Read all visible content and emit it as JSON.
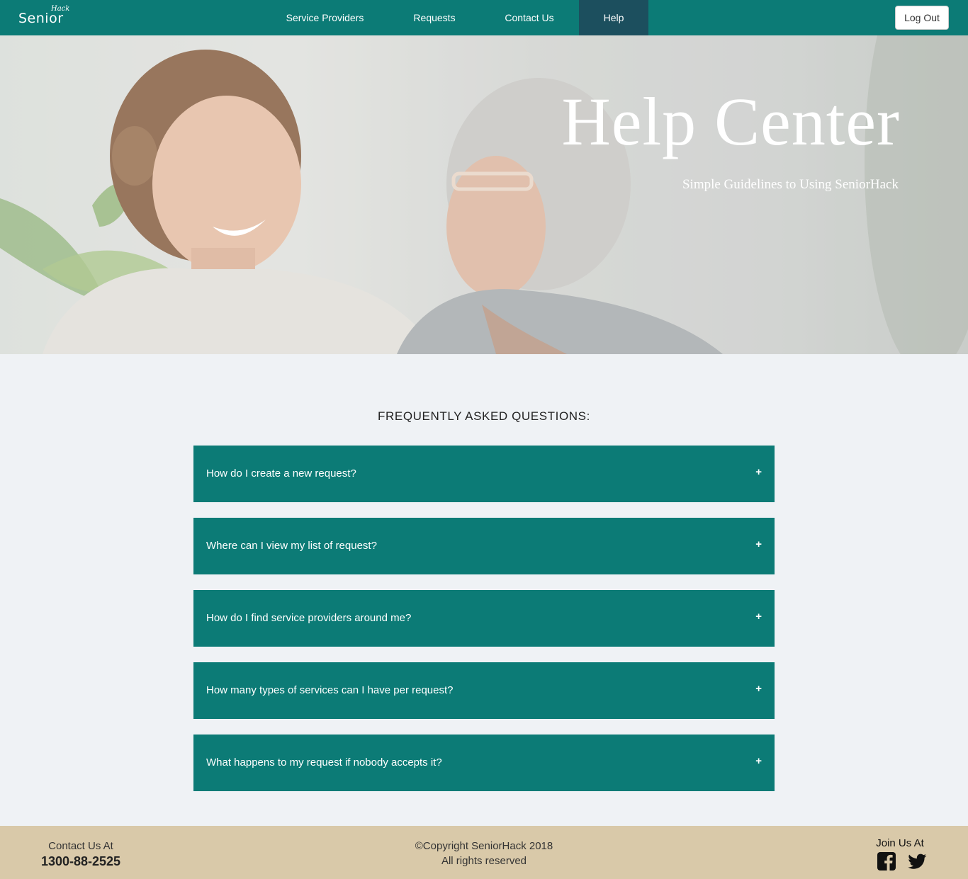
{
  "brand": {
    "main": "Senior",
    "small": "Hack"
  },
  "nav": {
    "items": [
      {
        "label": "Service Providers"
      },
      {
        "label": "Requests"
      },
      {
        "label": "Contact Us"
      },
      {
        "label": "Help",
        "active": true
      }
    ],
    "logout_label": "Log Out"
  },
  "hero": {
    "title": "Help Center",
    "subtitle": "Simple Guidelines to Using SeniorHack"
  },
  "faq": {
    "heading": "FREQUENTLY ASKED QUESTIONS:",
    "items": [
      {
        "question": "How do I create a new request?",
        "toggle": "+"
      },
      {
        "question": "Where can I view my list of request?",
        "toggle": "+"
      },
      {
        "question": "How do I find service providers around me?",
        "toggle": "+"
      },
      {
        "question": "How many types of services can I have per request?",
        "toggle": "+"
      },
      {
        "question": "What happens to my request if nobody accepts it?",
        "toggle": "+"
      }
    ]
  },
  "footer": {
    "contact_label": "Contact Us At",
    "phone": "1300-88-2525",
    "copyright": "©Copyright SeniorHack 2018",
    "rights": "All rights reserved",
    "join_label": "Join Us At",
    "social": [
      "facebook-icon",
      "twitter-icon"
    ]
  },
  "colors": {
    "primary": "#0c7b76",
    "nav_active": "#1c4f5e",
    "footer_bg": "#d9c9a9",
    "page_bg": "#eff2f5"
  }
}
